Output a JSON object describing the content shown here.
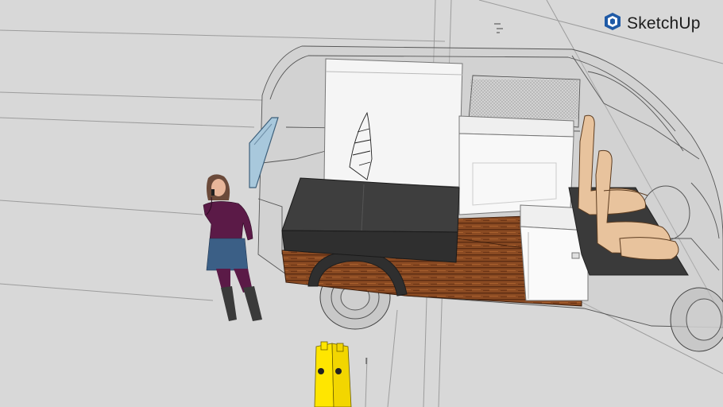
{
  "app": {
    "brand_name": "SketchUp",
    "brand_icon": "sketchup-logo-icon",
    "brand_color": "#1f5aa6"
  },
  "scene": {
    "background_color": "#d8d8d8",
    "floor_color": "#7a3e1c",
    "bed_color": "#3a3a3a",
    "figure_top_color": "#5b1a47",
    "figure_skirt_color": "#3b5f86",
    "jerrycan_color": "#ffe600",
    "seat_color": "#e8c39d"
  }
}
